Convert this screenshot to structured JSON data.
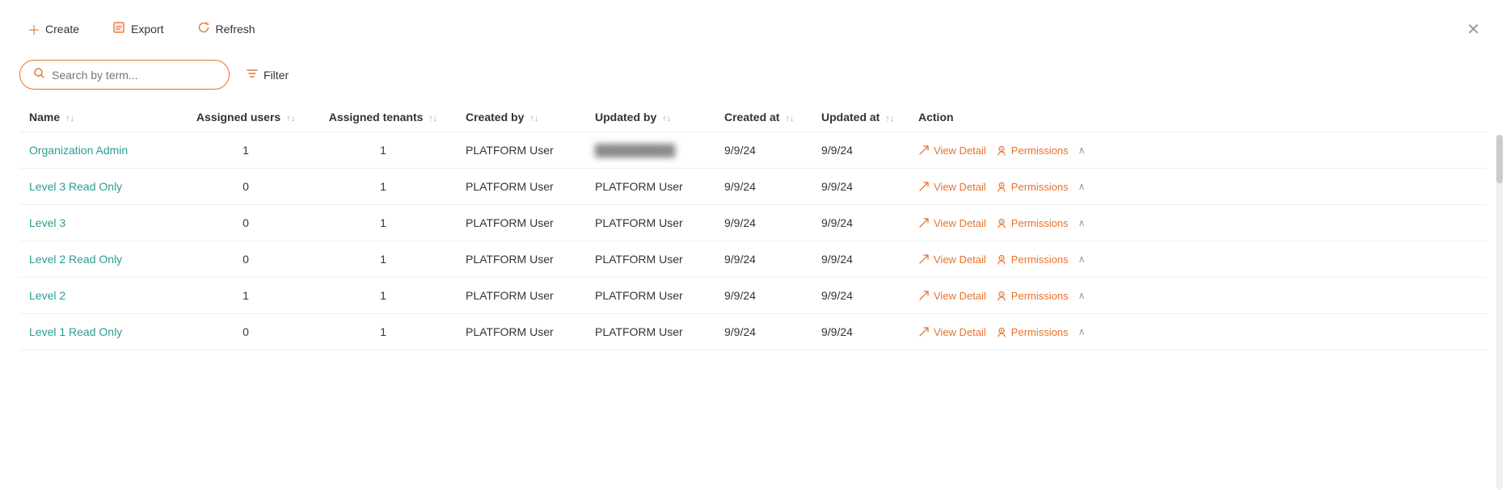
{
  "toolbar": {
    "create_label": "Create",
    "export_label": "Export",
    "refresh_label": "Refresh"
  },
  "search": {
    "placeholder": "Search by term..."
  },
  "filter": {
    "label": "Filter"
  },
  "close_label": "×",
  "table": {
    "columns": [
      {
        "key": "name",
        "label": "Name"
      },
      {
        "key": "assigned_users",
        "label": "Assigned users"
      },
      {
        "key": "assigned_tenants",
        "label": "Assigned tenants"
      },
      {
        "key": "created_by",
        "label": "Created by"
      },
      {
        "key": "updated_by",
        "label": "Updated by"
      },
      {
        "key": "created_at",
        "label": "Created at"
      },
      {
        "key": "updated_at",
        "label": "Updated at"
      },
      {
        "key": "action",
        "label": "Action"
      }
    ],
    "rows": [
      {
        "name": "Organization Admin",
        "assigned_users": "1",
        "assigned_tenants": "1",
        "created_by": "PLATFORM User",
        "updated_by": "BLURRED",
        "created_at": "9/9/24",
        "updated_at": "9/9/24"
      },
      {
        "name": "Level 3 Read Only",
        "assigned_users": "0",
        "assigned_tenants": "1",
        "created_by": "PLATFORM User",
        "updated_by": "PLATFORM User",
        "created_at": "9/9/24",
        "updated_at": "9/9/24"
      },
      {
        "name": "Level 3",
        "assigned_users": "0",
        "assigned_tenants": "1",
        "created_by": "PLATFORM User",
        "updated_by": "PLATFORM User",
        "created_at": "9/9/24",
        "updated_at": "9/9/24"
      },
      {
        "name": "Level 2 Read Only",
        "assigned_users": "0",
        "assigned_tenants": "1",
        "created_by": "PLATFORM User",
        "updated_by": "PLATFORM User",
        "created_at": "9/9/24",
        "updated_at": "9/9/24"
      },
      {
        "name": "Level 2",
        "assigned_users": "1",
        "assigned_tenants": "1",
        "created_by": "PLATFORM User",
        "updated_by": "PLATFORM User",
        "created_at": "9/9/24",
        "updated_at": "9/9/24"
      },
      {
        "name": "Level 1 Read Only",
        "assigned_users": "0",
        "assigned_tenants": "1",
        "created_by": "PLATFORM User",
        "updated_by": "PLATFORM User",
        "created_at": "9/9/24",
        "updated_at": "9/9/24"
      }
    ],
    "view_detail_label": "View Detail",
    "permissions_label": "Permissions"
  }
}
